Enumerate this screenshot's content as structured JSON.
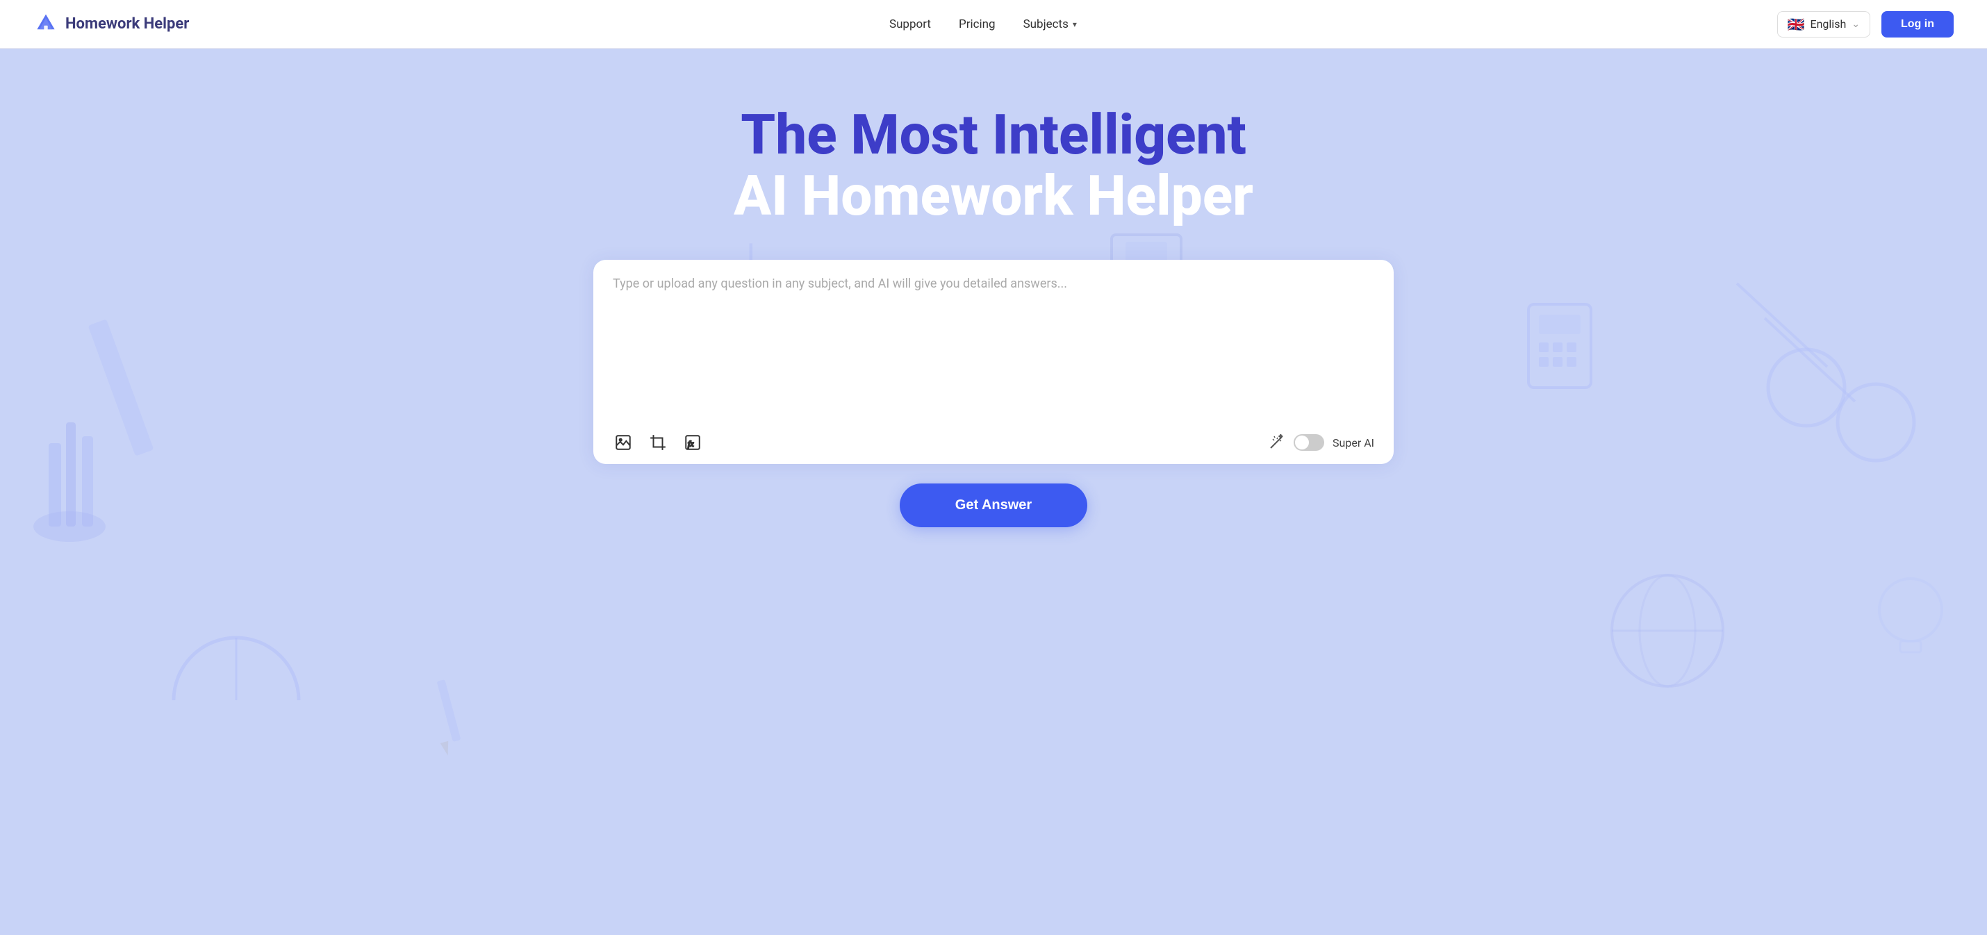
{
  "nav": {
    "logo_text": "Homework Helper",
    "links": [
      {
        "label": "Support",
        "key": "support"
      },
      {
        "label": "Pricing",
        "key": "pricing"
      },
      {
        "label": "Subjects",
        "key": "subjects"
      }
    ],
    "language": {
      "flag": "🇬🇧",
      "label": "English",
      "arrow": "⌄"
    },
    "login_label": "Log in"
  },
  "hero": {
    "title_line1": "The Most Intelligent",
    "title_line2": "AI Homework Helper",
    "textarea_placeholder": "Type or upload any question in any subject, and AI will give you detailed answers...",
    "super_ai_label": "Super AI",
    "get_answer_label": "Get Answer"
  },
  "toolbar_icons": {
    "image_label": "image-upload-icon",
    "crop_label": "crop-icon",
    "formula_label": "formula-icon",
    "wand_label": "magic-wand-icon"
  },
  "colors": {
    "primary": "#3d5af1",
    "hero_bg": "#c8d3f7",
    "title_line1": "#3d3dc8",
    "title_line2": "#ffffff"
  }
}
